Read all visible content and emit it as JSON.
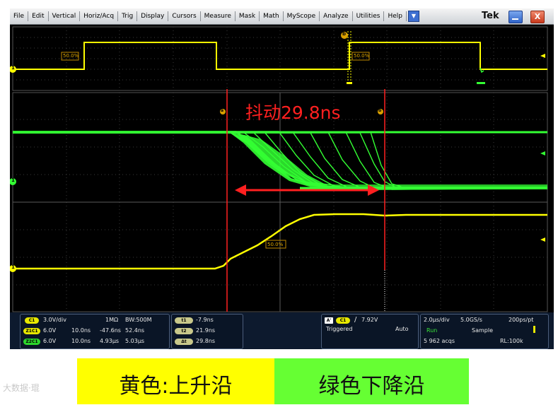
{
  "menu": {
    "items": [
      "File",
      "Edit",
      "Vertical",
      "Horiz/Acq",
      "Trig",
      "Display",
      "Cursors",
      "Measure",
      "Mask",
      "Math",
      "MyScope",
      "Analyze",
      "Utilities",
      "Help"
    ],
    "help_dropdown": "▼",
    "logo": "Tek",
    "close_label": "X"
  },
  "overview": {
    "ref_label_left": "50.0%",
    "ref_label_right": "50.0%",
    "cursor_b": "b",
    "channel_marker": "1"
  },
  "main": {
    "jitter_annotation": "抖动29.8ns",
    "cursor_a": "a",
    "cursor_b": "b",
    "ref_label": "50.0%",
    "ch1_marker": "1",
    "ch_green_marker": "1"
  },
  "readout": {
    "channels": [
      {
        "chip": "C1",
        "scale": "3.0V/div",
        "impedance": "1MΩ",
        "bw": "BW:500M"
      },
      {
        "chip": "Z1C1",
        "scale": "6.0V",
        "zoom_scale": "10.0ns",
        "pos1": "-47.6ns",
        "pos2": "52.4ns"
      },
      {
        "chip": "Z2C1",
        "scale": "6.0V",
        "zoom_scale": "10.0ns",
        "pos1": "4.93μs",
        "pos2": "5.03μs"
      }
    ],
    "cursors": [
      {
        "chip": "t1",
        "value": "-7.9ns"
      },
      {
        "chip": "t2",
        "value": "21.9ns"
      },
      {
        "chip": "Δt",
        "value": "29.8ns"
      }
    ],
    "trigger": {
      "mode_chip": "A'",
      "chip": "C1",
      "slope": "/",
      "level": "7.92V",
      "status": "Triggered",
      "auto": "Auto"
    },
    "acquisition": {
      "timebase": "2.0μs/div",
      "sample_rate": "5.0GS/s",
      "resolution": "200ps/pt",
      "state": "Run",
      "mode": "Sample",
      "acqs": "5 962 acqs",
      "record_length": "RL:100k"
    }
  },
  "legend": {
    "yellow_label": "黄色:上升沿",
    "green_label": "绿色下降沿"
  },
  "watermark": "大数据·琨",
  "colors": {
    "yellow_trace": "#ffff00",
    "green_trace": "#33ff33",
    "cursor_red": "#ff2020",
    "annotation_red": "#ff2020",
    "legend_yellow": "#ffff00",
    "legend_green": "#66ff33"
  }
}
